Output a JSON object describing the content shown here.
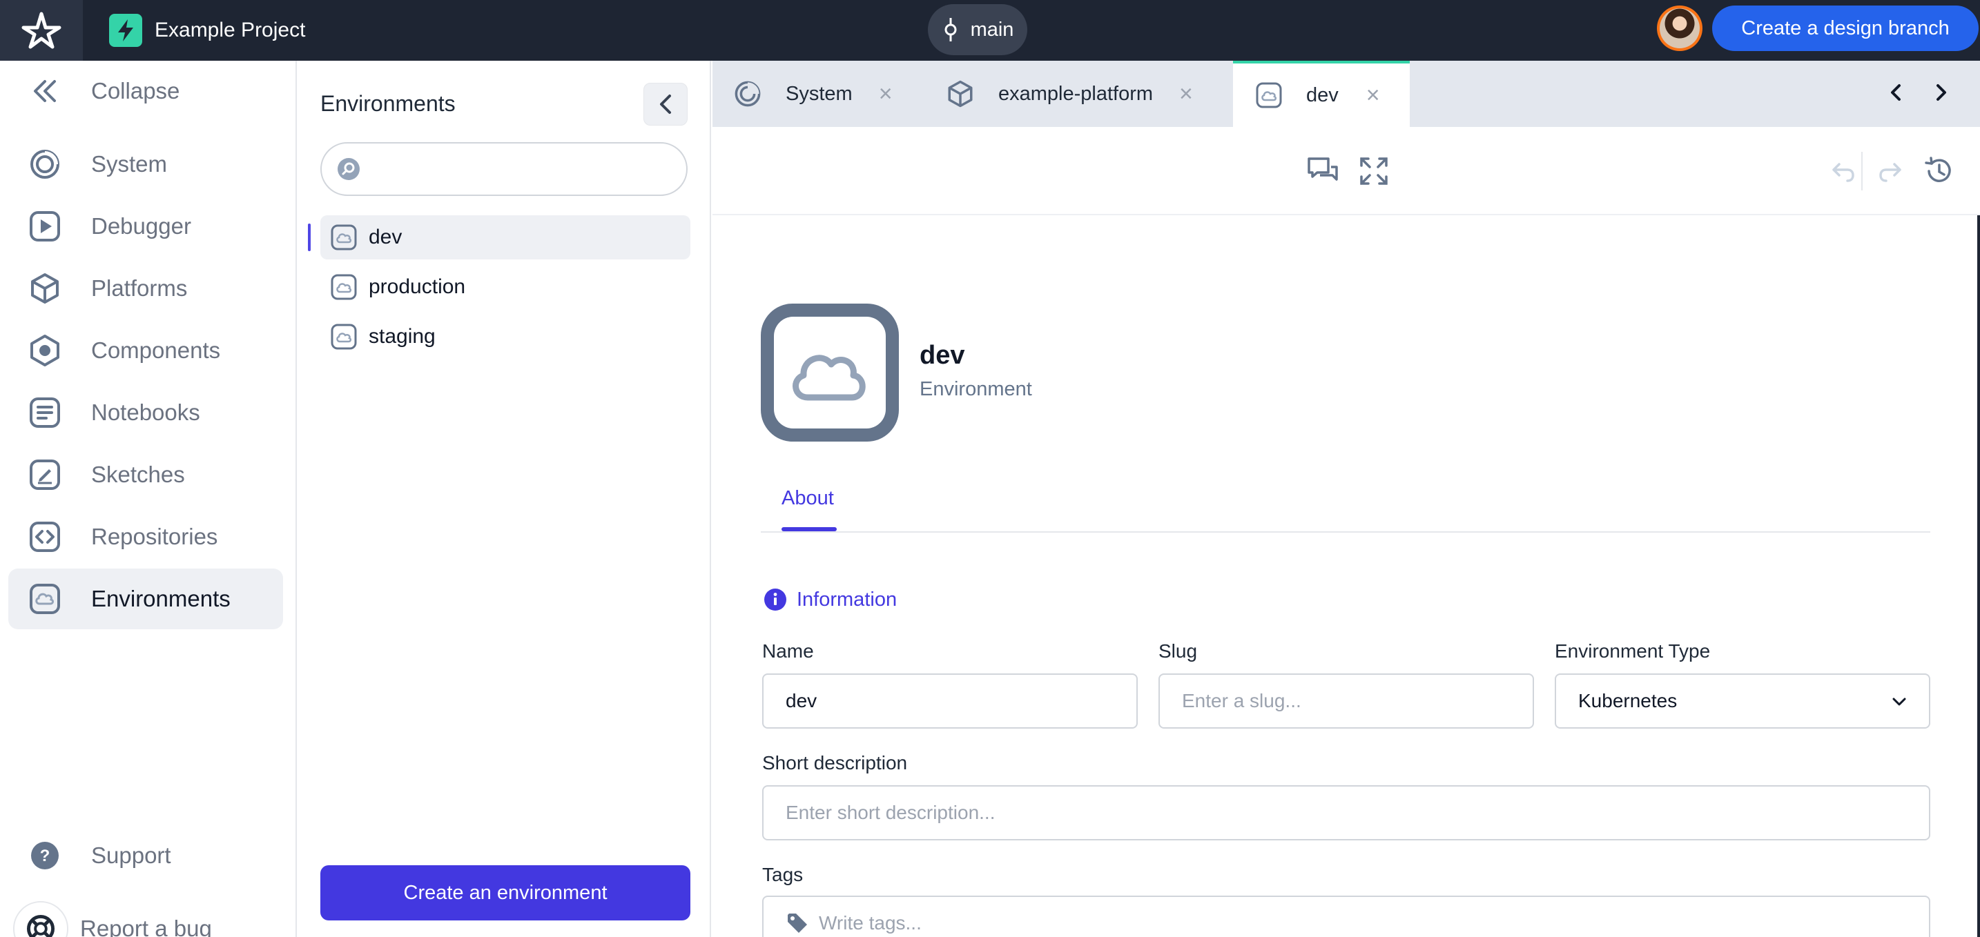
{
  "topbar": {
    "project_name": "Example Project",
    "branch": "main",
    "design_branch_button": "Create a design branch"
  },
  "sidebar": {
    "collapse_label": "Collapse",
    "items": [
      {
        "label": "System",
        "icon": "system-icon"
      },
      {
        "label": "Debugger",
        "icon": "play-icon"
      },
      {
        "label": "Platforms",
        "icon": "cube-icon"
      },
      {
        "label": "Components",
        "icon": "component-icon"
      },
      {
        "label": "Notebooks",
        "icon": "notebook-icon"
      },
      {
        "label": "Sketches",
        "icon": "sketch-icon"
      },
      {
        "label": "Repositories",
        "icon": "code-icon"
      },
      {
        "label": "Environments",
        "icon": "cloud-icon",
        "active": true
      }
    ],
    "support_label": "Support",
    "report_bug_label": "Report a bug"
  },
  "env_panel": {
    "title": "Environments",
    "search_placeholder": "",
    "items": [
      "dev",
      "production",
      "staging"
    ],
    "selected": "dev",
    "create_button": "Create an environment"
  },
  "tabs": [
    {
      "label": "System",
      "icon": "system-icon"
    },
    {
      "label": "example-platform",
      "icon": "cube-icon"
    },
    {
      "label": "dev",
      "icon": "cloud-icon",
      "active": true
    }
  ],
  "entity": {
    "name": "dev",
    "type": "Environment",
    "sub_tabs": [
      "About"
    ],
    "section_title": "Information",
    "fields": {
      "name_label": "Name",
      "name_value": "dev",
      "slug_label": "Slug",
      "slug_placeholder": "Enter a slug...",
      "env_type_label": "Environment Type",
      "env_type_value": "Kubernetes",
      "short_desc_label": "Short description",
      "short_desc_placeholder": "Enter short description...",
      "tags_label": "Tags",
      "tags_placeholder": "Write tags..."
    }
  },
  "colors": {
    "accent": "#4338e0",
    "topbar": "#1e2533",
    "brand_green": "#34d3a8",
    "primary_blue": "#2563eb"
  }
}
